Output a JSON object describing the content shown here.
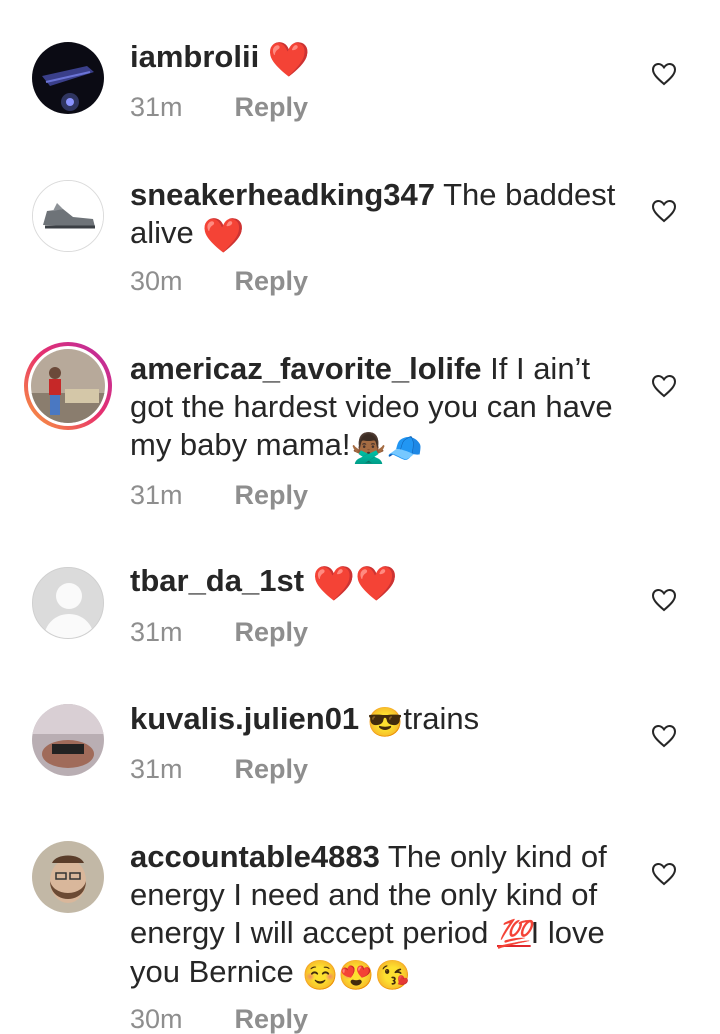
{
  "comments": [
    {
      "username": "iambrolii",
      "body": "",
      "emoji": "❤️",
      "time": "31m",
      "reply": "Reply"
    },
    {
      "username": "sneakerheadking347",
      "body": " The baddest alive ",
      "emoji": "❤️",
      "time": "30m",
      "reply": "Reply"
    },
    {
      "username": "americaz_favorite_lolife",
      "body": " If I ain’t got the hardest video you can have my baby mama!",
      "emoji": "🙅🏾‍♂️🧢",
      "time": "31m",
      "reply": "Reply"
    },
    {
      "username": "tbar_da_1st",
      "body": " ",
      "emoji": "❤️❤️",
      "time": "31m",
      "reply": "Reply"
    },
    {
      "username": "kuvalis.julien01",
      "body_emoji": " 😎",
      "body": "trains",
      "time": "31m",
      "reply": "Reply"
    },
    {
      "username": "accountable4883",
      "body": " The only kind of energy I need and the only kind of energy I will accept period ",
      "hundred": "💯",
      "body2": "I love you Bernice ",
      "emoji": "☺️😍😘",
      "time": "30m",
      "reply": "Reply"
    }
  ],
  "icons": {
    "like": "heart-outline-icon"
  },
  "colors": {
    "text": "#262626",
    "secondary": "#8e8e8e",
    "heart": "#ed1c24"
  }
}
